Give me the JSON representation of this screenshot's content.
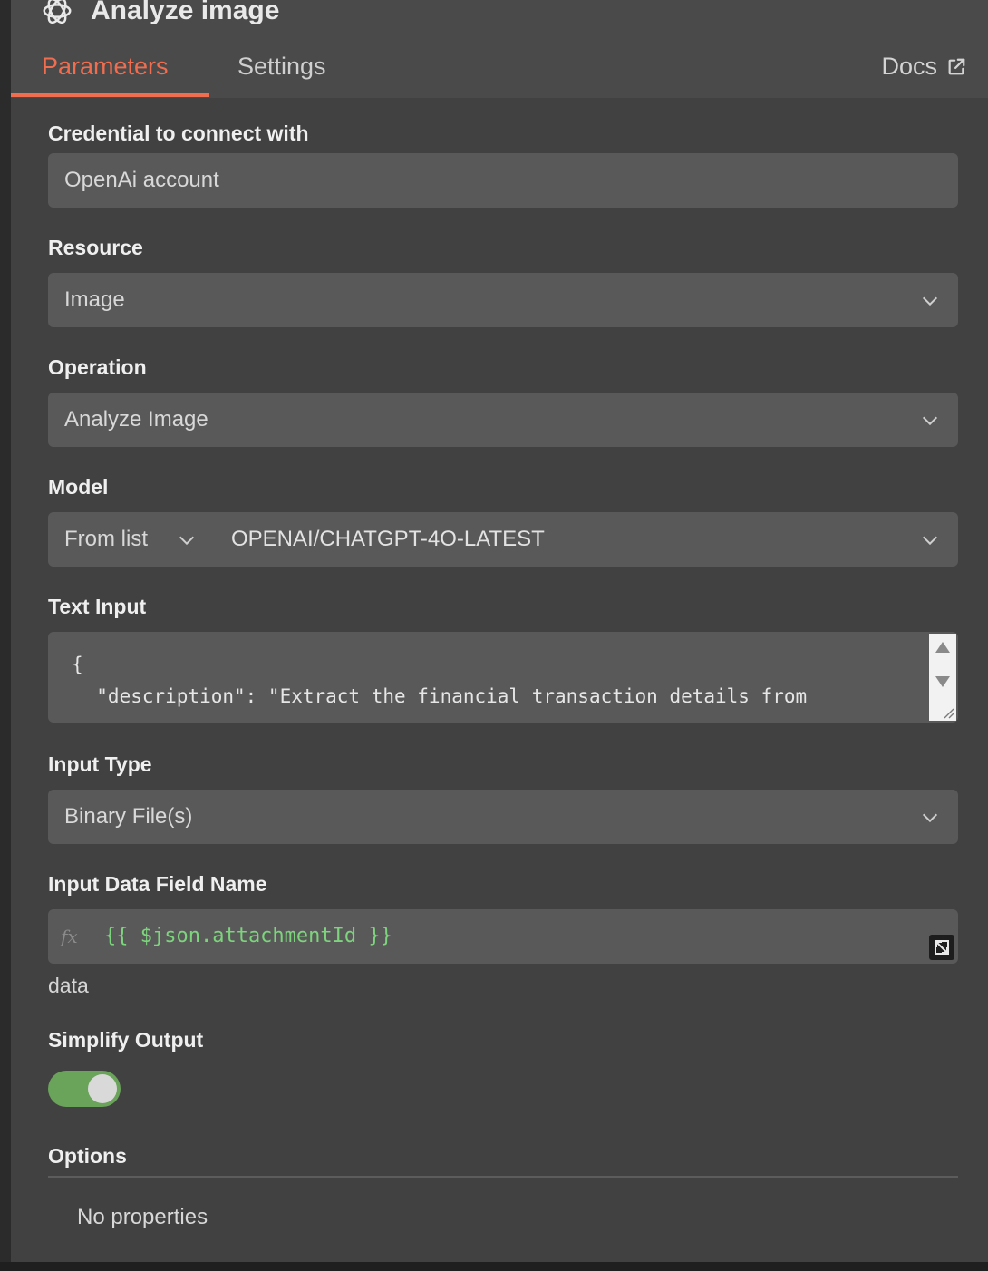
{
  "header": {
    "title": "Analyze image",
    "tabs": [
      {
        "label": "Parameters",
        "active": true
      },
      {
        "label": "Settings",
        "active": false
      }
    ],
    "docs_label": "Docs"
  },
  "fields": {
    "credential": {
      "label": "Credential to connect with",
      "value": "OpenAi account"
    },
    "resource": {
      "label": "Resource",
      "value": "Image"
    },
    "operation": {
      "label": "Operation",
      "value": "Analyze Image"
    },
    "model": {
      "label": "Model",
      "source": "From list",
      "value": "OPENAI/CHATGPT-4O-LATEST"
    },
    "text_input": {
      "label": "Text Input",
      "lines": [
        "{",
        "  \"description\": \"Extract the financial transaction details from"
      ]
    },
    "input_type": {
      "label": "Input Type",
      "value": "Binary File(s)"
    },
    "input_data_field": {
      "label": "Input Data Field Name",
      "fx": "fx",
      "expression": "{{ $json.attachmentId }}",
      "hint": "data"
    },
    "simplify_output": {
      "label": "Simplify Output",
      "enabled": true
    },
    "options": {
      "label": "Options",
      "empty_text": "No properties"
    }
  },
  "colors": {
    "accent": "#f06d4f",
    "toggle_on": "#6aa35a",
    "expression": "#7dd47d"
  },
  "icons": [
    "openai-logo-icon",
    "external-link-icon",
    "chevron-down-icon",
    "scroll-up-icon",
    "scroll-down-icon",
    "resize-grip-icon",
    "expand-icon"
  ]
}
